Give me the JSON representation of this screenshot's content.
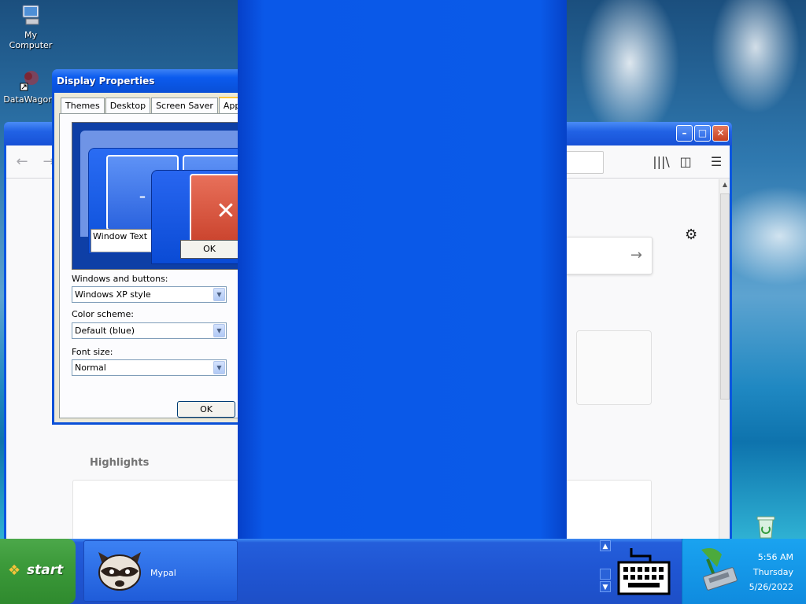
{
  "desktop": {
    "icons": [
      {
        "label": "My Computer"
      },
      {
        "label": "DataWagon."
      }
    ]
  },
  "browser": {
    "nav": {
      "back": "←",
      "forward": "→"
    },
    "window_controls": {
      "minimize": "–",
      "maximize": "□",
      "close": "✕"
    },
    "toolbar_icons": {
      "library": "|||\\",
      "sidebar": "◫",
      "menu": "☰"
    },
    "search_arrow": "→",
    "settings_glyph": "⚙",
    "highlights_label": "Highlights"
  },
  "dialog": {
    "title": "Display Properties",
    "tabs": [
      {
        "label": "Themes"
      },
      {
        "label": "Desktop"
      },
      {
        "label": "Screen Saver"
      },
      {
        "label": "Appeara"
      }
    ],
    "preview": {
      "minimize_glyph": "-",
      "close_glyph": "✕",
      "window_text": "Window Text",
      "ok_label": "OK"
    },
    "windows_and_buttons": {
      "label": "Windows and buttons:",
      "value": "Windows XP style"
    },
    "color_scheme": {
      "label": "Color scheme:",
      "value": "Default (blue)"
    },
    "font_size": {
      "label": "Font size:",
      "value": "Normal"
    },
    "ok_label": "OK"
  },
  "taskbar": {
    "start_label": "start",
    "task": {
      "label": "Mypal"
    },
    "clock": {
      "time": "5:56 AM",
      "day": "Thursday",
      "date": "5/26/2022"
    }
  }
}
